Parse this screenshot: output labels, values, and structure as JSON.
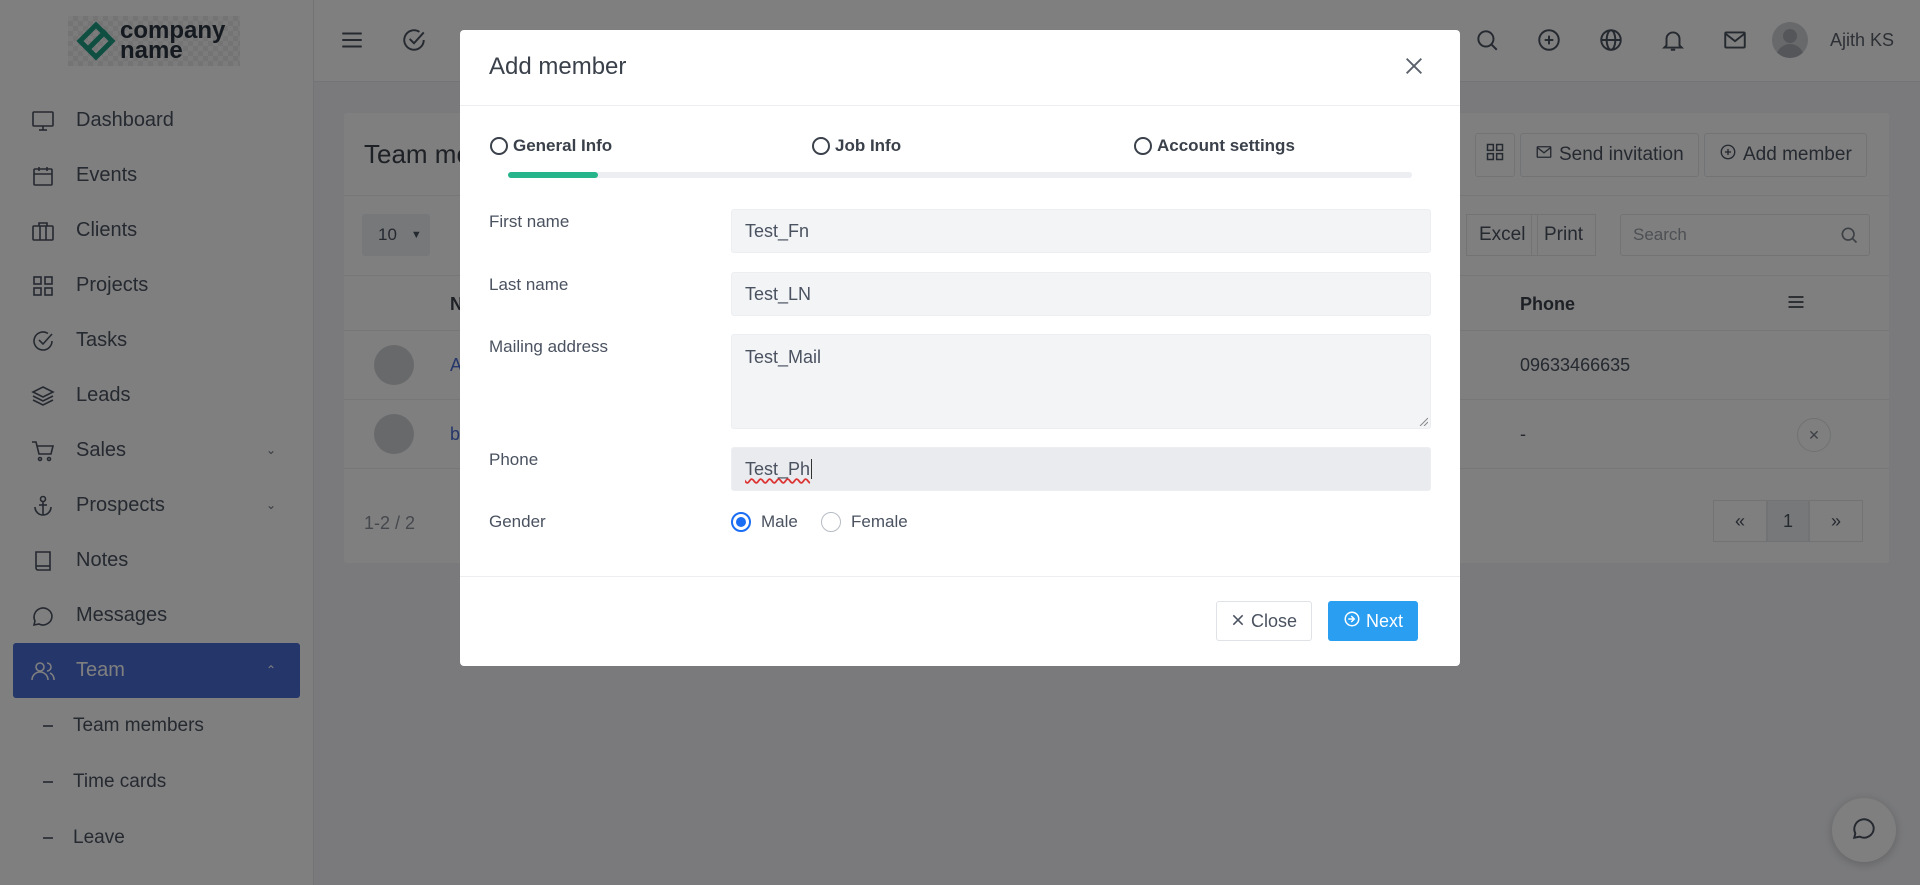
{
  "brand": {
    "line1": "company",
    "line2": "name"
  },
  "sidebar": {
    "items": [
      {
        "label": "Dashboard",
        "icon": "monitor-icon"
      },
      {
        "label": "Events",
        "icon": "calendar-icon"
      },
      {
        "label": "Clients",
        "icon": "briefcase-icon"
      },
      {
        "label": "Projects",
        "icon": "grid-icon"
      },
      {
        "label": "Tasks",
        "icon": "check-circle-icon"
      },
      {
        "label": "Leads",
        "icon": "layers-icon"
      },
      {
        "label": "Sales",
        "icon": "cart-icon"
      },
      {
        "label": "Prospects",
        "icon": "anchor-icon"
      },
      {
        "label": "Notes",
        "icon": "book-icon"
      },
      {
        "label": "Messages",
        "icon": "chat-icon"
      },
      {
        "label": "Team",
        "icon": "users-icon"
      }
    ],
    "subitems": [
      "Team members",
      "Time cards",
      "Leave"
    ]
  },
  "topbar": {
    "user_name": "Ajith KS"
  },
  "page": {
    "title": "Team me",
    "send_invitation": "Send invitation",
    "add_member": "Add member",
    "page_size": "10",
    "excel": "Excel",
    "print": "Print",
    "search_placeholder": "Search",
    "col_name": "N",
    "col_phone": "Phone",
    "rows": [
      {
        "name": "A",
        "phone": "09633466635"
      },
      {
        "name": "b",
        "phone": "-"
      }
    ],
    "pager_info": "1-2 / 2",
    "page_number": "1"
  },
  "modal": {
    "title": "Add member",
    "steps": [
      "General Info",
      "Job Info",
      "Account settings"
    ],
    "progress_fraction": 0.1,
    "fields": {
      "first_name_label": "First name",
      "first_name_value": "Test_Fn",
      "last_name_label": "Last name",
      "last_name_value": "Test_LN",
      "mailing_label": "Mailing address",
      "mailing_value": "Test_Mail",
      "phone_label": "Phone",
      "phone_value": "Test_Ph",
      "gender_label": "Gender",
      "gender_male": "Male",
      "gender_female": "Female"
    },
    "close_label": "Close",
    "next_label": "Next"
  },
  "colors": {
    "accent": "#4a6cd4",
    "primary_button": "#2a9ef0",
    "progress": "#26b48a",
    "radio": "#1b6ef3"
  }
}
